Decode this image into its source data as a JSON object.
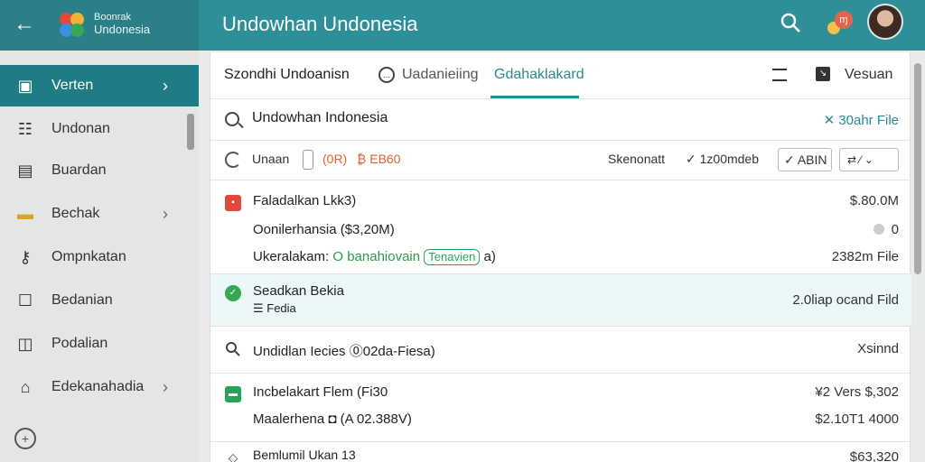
{
  "header": {
    "brand_line1": "Boonrak",
    "brand_line2": "Undonesia",
    "title": "Undowhan Undonesia",
    "notif_badge": "ɱ",
    "colors": {
      "header_bg": "#2f8f99",
      "accent": "#1f7c87"
    }
  },
  "sidebar": {
    "items": [
      {
        "label": "Verten",
        "icon": "clipboard-icon",
        "chevron": "›",
        "active": true
      },
      {
        "label": "Undonan",
        "icon": "list-icon",
        "chevron": ""
      },
      {
        "label": "Buardan",
        "icon": "calendar-icon",
        "chevron": ""
      },
      {
        "label": "Bechak",
        "icon": "folder-icon",
        "chevron": "›"
      },
      {
        "label": "Ompnkatan",
        "icon": "key-icon",
        "chevron": ""
      },
      {
        "label": "Bedanian",
        "icon": "square-icon",
        "chevron": ""
      },
      {
        "label": "Podalian",
        "icon": "box-icon",
        "chevron": ""
      },
      {
        "label": "Edekanahadia",
        "icon": "home-icon",
        "chevron": "›"
      }
    ]
  },
  "tabs": {
    "tab1": "Szondhi Undoanisn",
    "tab2": "Uadanieiing",
    "tab3": "Gdahaklakard",
    "version": "Vesuan"
  },
  "search": {
    "value": "Undowhan Indonesia",
    "right_label": "✕ 30ahr File"
  },
  "filter": {
    "label": "Unaan",
    "tag1": "(0R)",
    "tag2": "₿ EB60",
    "right1": "Skenonatt",
    "right2": "✓ 1z00mdeb",
    "select": "✓ ABIN",
    "select2": "⇄ ⁄ ⌄"
  },
  "rows": [
    {
      "title": "Faladalkan Lkk3)",
      "right": "$.80.0M"
    },
    {
      "title": "Oonilerhansia ($3,20M)",
      "right": "0"
    },
    {
      "title": "Ukeralakam: ",
      "green_text": "O banahiovain",
      "pill": "Tenavien",
      "tail": " a)",
      "right": "2382m File"
    },
    {
      "title": "Seadkan Bekia",
      "sub": "☰ Fedia",
      "right": "2.0liap ocand Fild"
    },
    {
      "title": "Undidlan Iecies ⓪02da-Fiesa)",
      "right": "Xsinnd"
    },
    {
      "title": "Incbelakart Flem (Fi30",
      "right": "¥2 Vers $,302"
    },
    {
      "title": "Maalerhena ◘ (A 02.388V)",
      "right": "$2.10T1 4000"
    },
    {
      "title": "Bemlumil Ukan 13",
      "right": "$63,320"
    }
  ]
}
